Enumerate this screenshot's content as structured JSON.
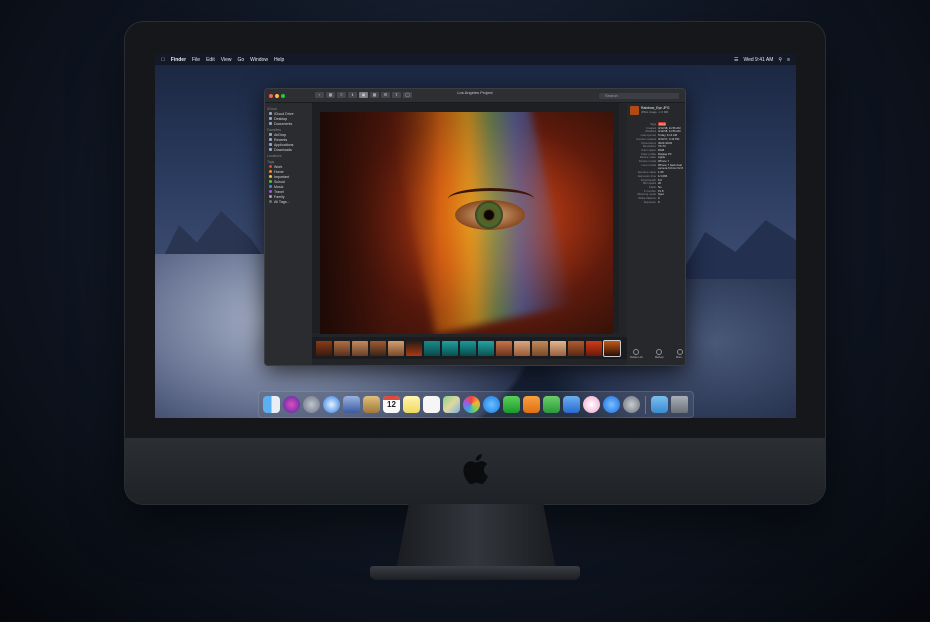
{
  "menubar": {
    "apple": "",
    "app": "Finder",
    "items": [
      "File",
      "Edit",
      "View",
      "Go",
      "Window",
      "Help"
    ],
    "clock": "Wed 9:41 AM"
  },
  "finder": {
    "title": "Los Angeles Project",
    "search_placeholder": "Search",
    "sidebar": {
      "sections": [
        {
          "title": "iCloud",
          "items": [
            "iCloud Drive",
            "Desktop",
            "Documents"
          ]
        },
        {
          "title": "Favorites",
          "items": [
            "AirDrop",
            "Recents",
            "Applications",
            "Downloads"
          ]
        },
        {
          "title": "Locations",
          "items": []
        }
      ],
      "tags_title": "Tags",
      "tags": [
        {
          "label": "Work",
          "color": "#e0443a"
        },
        {
          "label": "Home",
          "color": "#f08a24"
        },
        {
          "label": "Important",
          "color": "#f2c230"
        },
        {
          "label": "School",
          "color": "#5cb85c"
        },
        {
          "label": "Music",
          "color": "#3b8fe0"
        },
        {
          "label": "Travel",
          "color": "#9a5ad6"
        },
        {
          "label": "Family",
          "color": "#a0a3a8"
        },
        {
          "label": "All Tags...",
          "color": "#6c6f75"
        }
      ]
    },
    "inspector": {
      "name": "Rainbow_Eye.JPG",
      "subtitle": "JPEG image - 1.6 MB",
      "tag_label": "Tags",
      "tag_value": "Work",
      "rows": [
        {
          "k": "Created",
          "v": "4/12/18, 11:56 AM"
        },
        {
          "k": "Modified",
          "v": "4/12/18, 11:56 AM"
        },
        {
          "k": "Last opened",
          "v": "Today, 9:14 AM"
        },
        {
          "k": "Content created",
          "v": "4/23/17, 4:43 PM"
        },
        {
          "k": "Dimensions",
          "v": "3024×4032"
        },
        {
          "k": "Resolution",
          "v": "72×72"
        },
        {
          "k": "Color space",
          "v": "RGB"
        },
        {
          "k": "Color profile",
          "v": "Display P3"
        },
        {
          "k": "Device make",
          "v": "Apple"
        },
        {
          "k": "Device model",
          "v": "iPhone 7"
        },
        {
          "k": "Lens model",
          "v": "iPhone 7 back dual"
        },
        {
          "k": "",
          "v": "camera 6.6mm f/2.8"
        },
        {
          "k": "Aperture value",
          "v": "1.69"
        },
        {
          "k": "Exposure time",
          "v": "1/1,084"
        },
        {
          "k": "Focal length",
          "v": "6.6"
        },
        {
          "k": "ISO speed",
          "v": "20"
        },
        {
          "k": "Flash",
          "v": "No"
        },
        {
          "k": "F number",
          "v": "f/1.8"
        },
        {
          "k": "Metering mode",
          "v": "Spot"
        },
        {
          "k": "White balance",
          "v": "0"
        },
        {
          "k": "Exposure",
          "v": "0"
        }
      ],
      "actions": [
        "Rotate Left",
        "Markup",
        "More..."
      ]
    }
  },
  "dock": {
    "apps": [
      "Finder",
      "Siri",
      "Launchpad",
      "Safari",
      "Contacts",
      "Notes",
      "Calendar",
      "Stickies",
      "Reminders",
      "Maps",
      "Photos",
      "Messages",
      "FaceTime",
      "Pages",
      "Numbers",
      "Keynote",
      "iTunes",
      "App Store",
      "System Preferences"
    ],
    "calendar_day": "12",
    "trailing": [
      "Downloads",
      "Trash"
    ]
  }
}
